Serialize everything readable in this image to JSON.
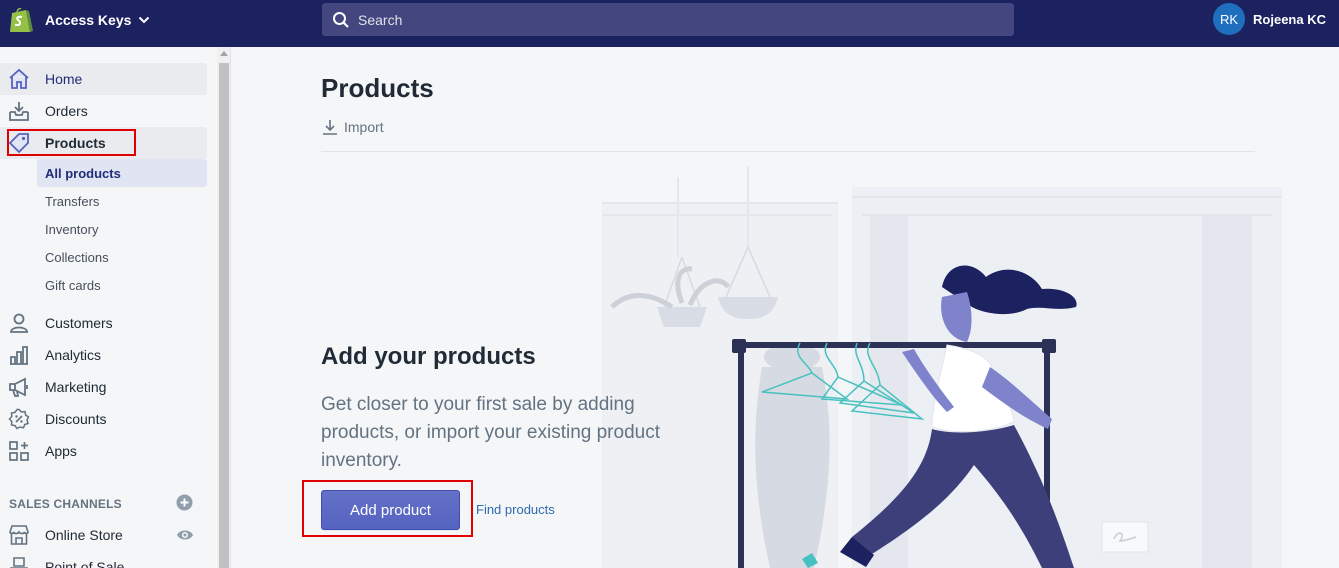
{
  "topbar": {
    "store_name": "Access Keys",
    "search_placeholder": "Search",
    "user_initials": "RK",
    "user_name": "Rojeena KC"
  },
  "sidebar": {
    "items": [
      {
        "label": "Home",
        "icon": "home-icon"
      },
      {
        "label": "Orders",
        "icon": "orders-icon"
      },
      {
        "label": "Products",
        "icon": "tag-icon"
      },
      {
        "label": "Customers",
        "icon": "person-icon"
      },
      {
        "label": "Analytics",
        "icon": "bar-chart-icon"
      },
      {
        "label": "Marketing",
        "icon": "megaphone-icon"
      },
      {
        "label": "Discounts",
        "icon": "discount-icon"
      },
      {
        "label": "Apps",
        "icon": "apps-icon"
      }
    ],
    "product_subitems": [
      "All products",
      "Transfers",
      "Inventory",
      "Collections",
      "Gift cards"
    ],
    "sales_channels_title": "SALES CHANNELS",
    "channels": [
      {
        "label": "Online Store",
        "icon": "store-icon"
      },
      {
        "label": "Point of Sale",
        "icon": "pos-icon"
      }
    ]
  },
  "main": {
    "title": "Products",
    "import_label": "Import",
    "empty_title": "Add your products",
    "empty_text": "Get closer to your first sale by adding products, or import your existing product inventory.",
    "add_button": "Add product",
    "find_link": "Find products"
  },
  "colors": {
    "topbar": "#1c2260",
    "search": "#43467f",
    "primary_button": "#5c6ac4",
    "highlight_box": "#e00000",
    "link": "#2e6bb0"
  }
}
